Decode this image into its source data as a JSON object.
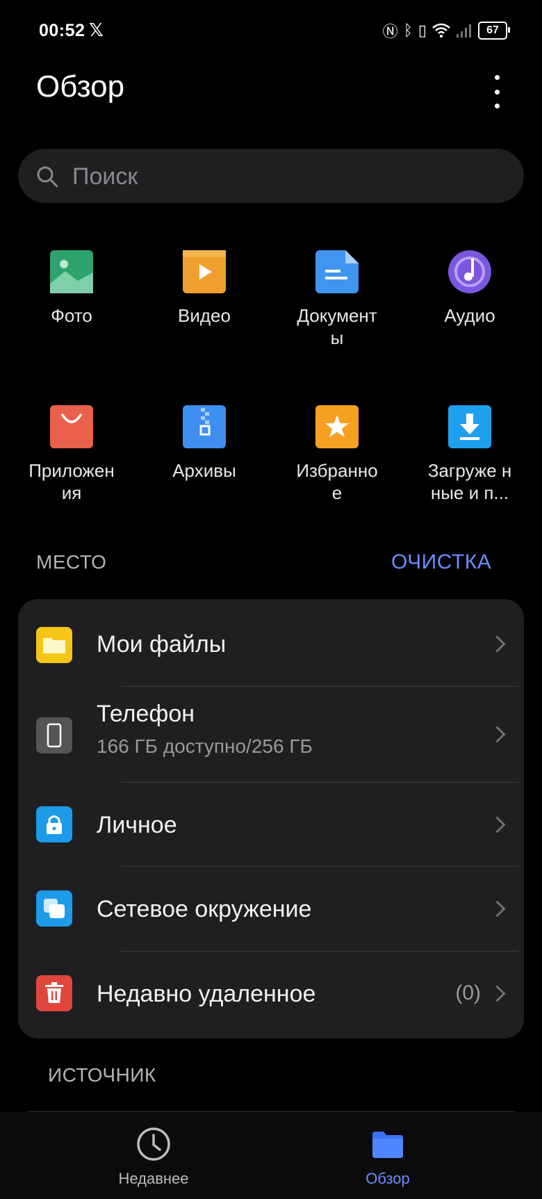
{
  "status_bar": {
    "time": "00:52",
    "battery": "67"
  },
  "header": {
    "title": "Обзор"
  },
  "search": {
    "placeholder": "Поиск"
  },
  "categories": [
    {
      "label": "Фото",
      "icon": "photo-icon",
      "color": "#2ea36e"
    },
    {
      "label": "Видео",
      "icon": "video-icon",
      "color": "#f0a030"
    },
    {
      "label": "Документ ы",
      "icon": "document-icon",
      "color": "#3f95f0"
    },
    {
      "label": "Аудио",
      "icon": "audio-icon",
      "color": "#7b57e0"
    },
    {
      "label": "Приложен ия",
      "icon": "apps-icon",
      "color": "#e9604b"
    },
    {
      "label": "Архивы",
      "icon": "archive-icon",
      "color": "#3f8ff0"
    },
    {
      "label": "Избранно е",
      "icon": "favorites-icon",
      "color": "#f5a020"
    },
    {
      "label": "Загруже нные и п...",
      "icon": "downloads-icon",
      "color": "#1fa0ee"
    }
  ],
  "location_section": {
    "title": "МЕСТО",
    "action": "ОЧИСТКА"
  },
  "locations": [
    {
      "title": "Мои файлы",
      "icon": "folder-icon",
      "color": "#f5c518"
    },
    {
      "title": "Телефон",
      "subtitle": "166 ГБ доступно/256 ГБ",
      "icon": "phone-icon",
      "color": "#555558"
    },
    {
      "title": "Личное",
      "icon": "lock-icon",
      "color": "#1d9be8"
    },
    {
      "title": "Сетевое окружение",
      "icon": "network-icon",
      "color": "#1d9be8"
    },
    {
      "title": "Недавно удаленное",
      "count": "(0)",
      "icon": "trash-icon",
      "color": "#e0463c"
    }
  ],
  "source_section": {
    "title": "ИСТОЧНИК"
  },
  "bottom_nav": [
    {
      "label": "Недавнее",
      "icon": "clock-icon",
      "active": false
    },
    {
      "label": "Обзор",
      "icon": "folder-icon",
      "active": true
    }
  ],
  "colors": {
    "accent": "#6c8cff",
    "card": "#1f1f21",
    "background": "#000000"
  }
}
